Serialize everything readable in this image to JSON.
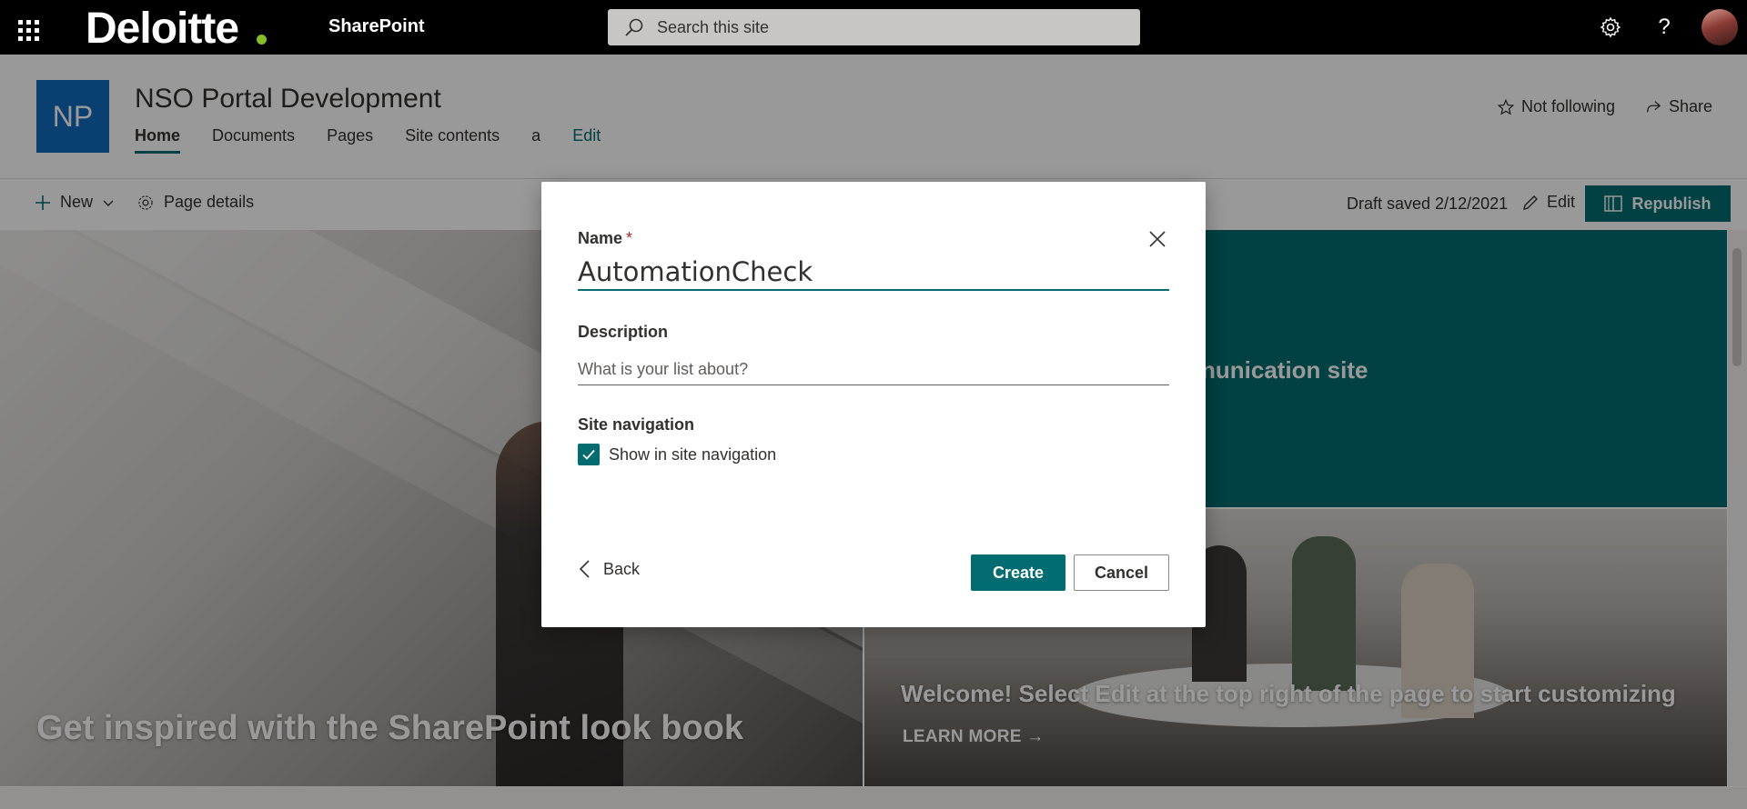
{
  "suitebar": {
    "logo_text": "Deloitte",
    "app_name": "SharePoint",
    "search_placeholder": "Search this site",
    "icons": [
      "app-launcher-icon",
      "settings-icon",
      "help-icon",
      "avatar"
    ]
  },
  "site": {
    "logo_initials": "NP",
    "title": "NSO Portal Development",
    "nav": [
      {
        "label": "Home",
        "active": true
      },
      {
        "label": "Documents"
      },
      {
        "label": "Pages"
      },
      {
        "label": "Site contents"
      },
      {
        "label": "a"
      },
      {
        "label": "Edit"
      }
    ],
    "follow_label": "Not following",
    "share_label": "Share"
  },
  "commandbar": {
    "new_label": "New",
    "page_details_label": "Page details",
    "draft_status": "Draft saved 2/12/2021",
    "edit_label": "Edit",
    "republish_label": "Republish"
  },
  "hero": {
    "left_caption": "Get inspired with the SharePoint look book",
    "top_right_caption": "nunication site",
    "bottom_right_caption": "Welcome! Select Edit at the top right of the page to start customizing",
    "learn_more": "LEARN MORE →"
  },
  "dialog": {
    "name_label": "Name",
    "required_marker": "*",
    "name_value": "AutomationCheck",
    "description_label": "Description",
    "description_placeholder": "What is your list about?",
    "site_navigation_label": "Site navigation",
    "show_in_nav_label": "Show in site navigation",
    "show_in_nav_checked": true,
    "back_label": "Back",
    "create_label": "Create",
    "cancel_label": "Cancel"
  },
  "colors": {
    "accent": "#036c70",
    "suitebar": "#000000",
    "site_logo": "#0f6cbd",
    "brand_dot": "#86bc25"
  }
}
